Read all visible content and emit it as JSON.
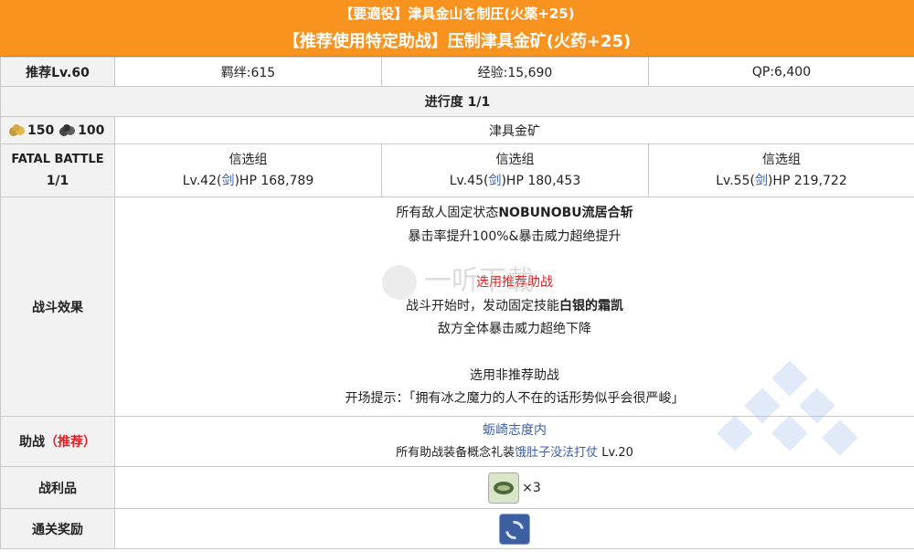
{
  "header": {
    "title_jp": "【要適役】津具金山を制圧(火薬+25)",
    "title_cn": "【推荐使用特定助战】压制津具金矿(火药+25)"
  },
  "rewards": {
    "label": "推荐Lv.60",
    "bond": "羁绊:615",
    "exp": "经验:15,690",
    "qp": "QP:6,400"
  },
  "progress": "进行度 1/1",
  "ap": {
    "value1": "150",
    "value2": "100",
    "stage_name": "津具金矿"
  },
  "fatal": {
    "label1": "FATAL BATTLE",
    "label2": "1/1",
    "enemies": [
      {
        "name": "信选组",
        "lv": "Lv.42(",
        "cls": "剑",
        "hp": ")HP 168,789"
      },
      {
        "name": "信选组",
        "lv": "Lv.45(",
        "cls": "剑",
        "hp": ")HP 180,453"
      },
      {
        "name": "信选组",
        "lv": "Lv.55(",
        "cls": "剑",
        "hp": ")HP 219,722"
      }
    ]
  },
  "effects": {
    "label": "战斗效果",
    "l1_pre": "所有敌人固定状态",
    "l1_bold": "NOBUNOBU流居合斩",
    "l2": "暴击率提升100%&暴击威力超绝提升",
    "l3": "选用推荐助战",
    "l4_pre": "战斗开始时，发动固定技能",
    "l4_bold": "白银的霜凯",
    "l5": "敌方全体暴击威力超绝下降",
    "l6": "选用非推荐助战",
    "l7": "开场提示：「拥有冰之魔力的人不在的话形势似乎会很严峻」"
  },
  "support": {
    "label": "助战",
    "label_rec": "（推荐）",
    "servant": "蛎崎志度内",
    "ce_pre": "所有助战装备概念礼装",
    "ce_name": "饿肚子没法打仗",
    "ce_lv": " Lv.20"
  },
  "drops": {
    "label": "战利品",
    "qty": "×3"
  },
  "clear": {
    "label": "通关奖励"
  },
  "watermark": "一听下载"
}
